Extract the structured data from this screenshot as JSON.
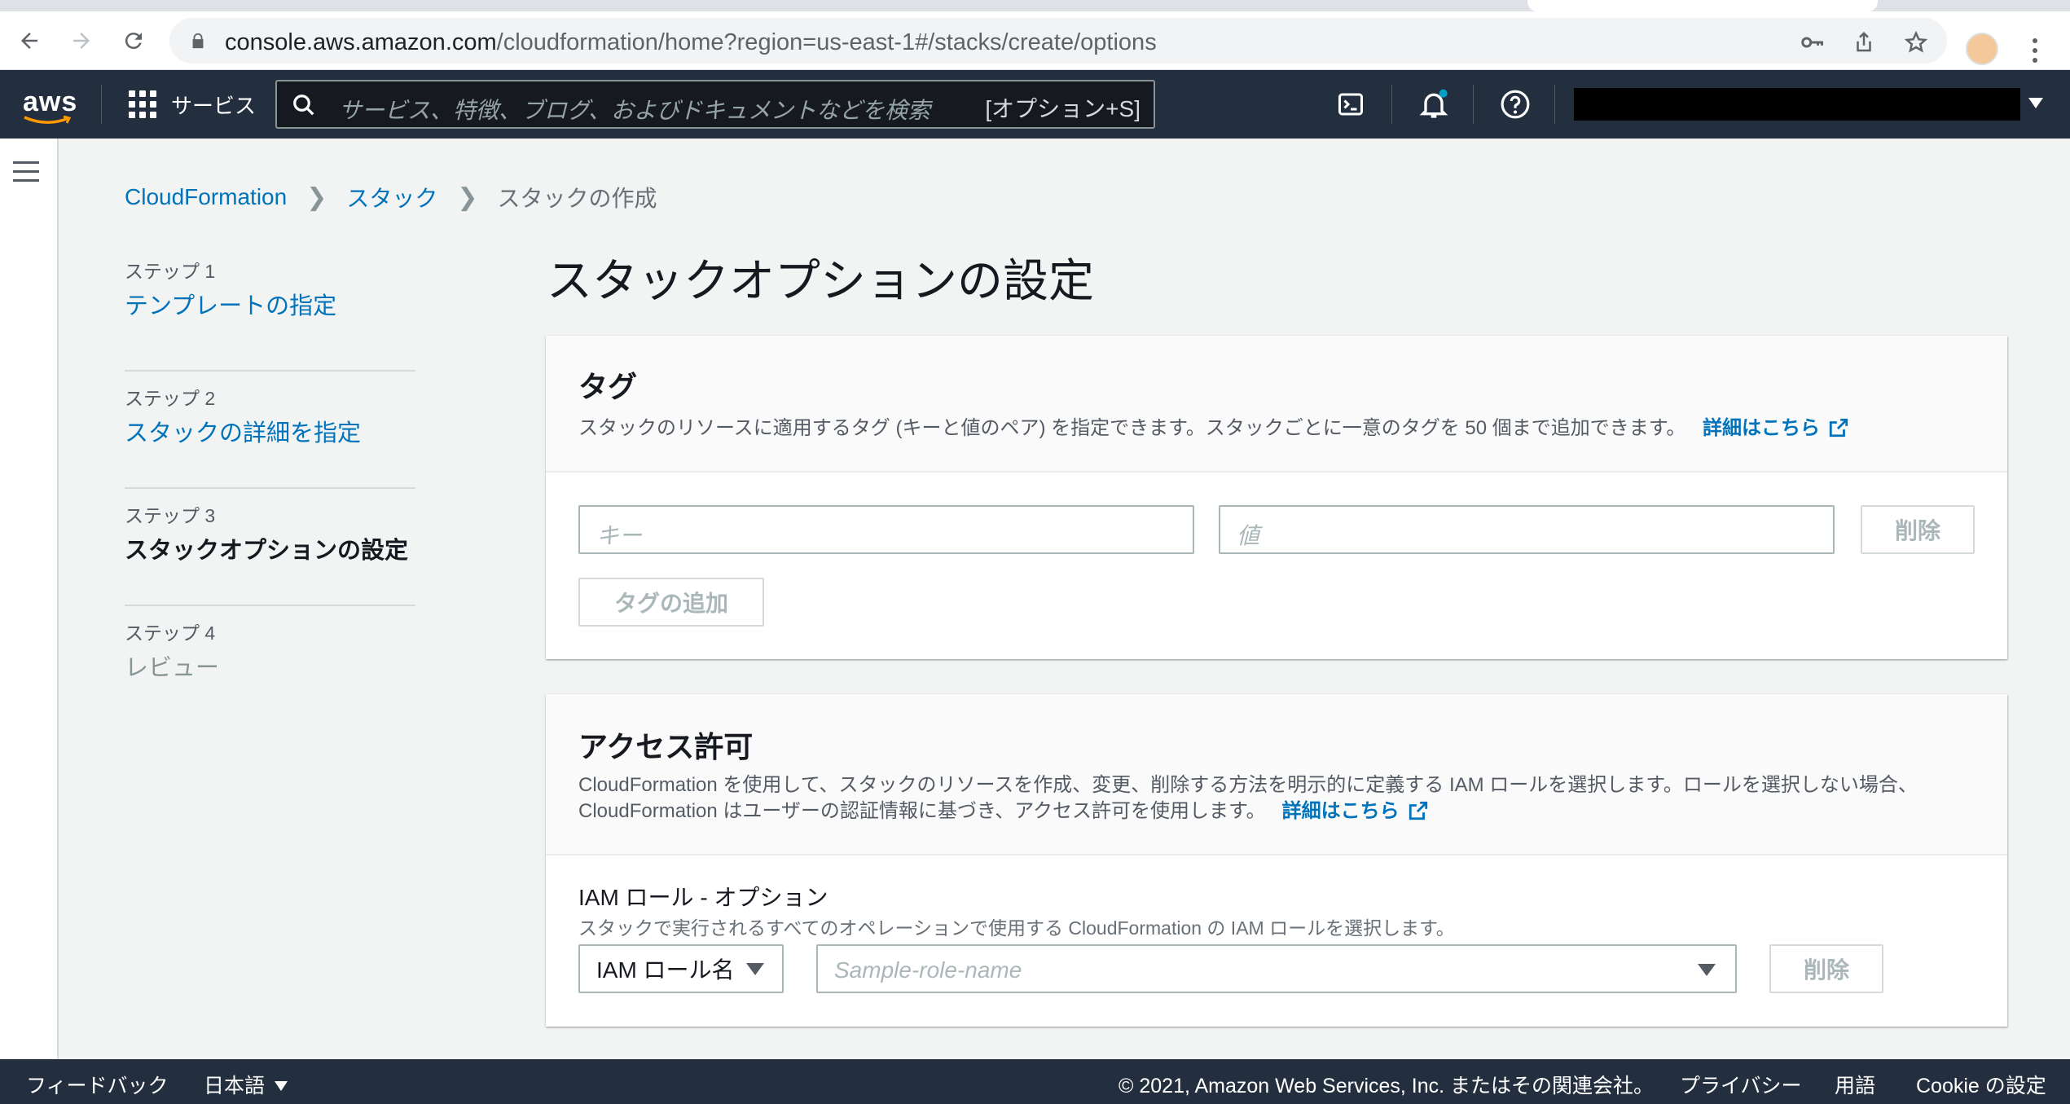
{
  "browser": {
    "url_host": "console.aws.amazon.com",
    "url_path": "/cloudformation/home?region=us-east-1#/stacks/create/options"
  },
  "awsnav": {
    "logo": "aws",
    "services_label": "サービス",
    "search_placeholder": "サービス、特徴、ブログ、およびドキュメントなどを検索",
    "search_shortcut": "[オプション+S]"
  },
  "breadcrumb": {
    "items": [
      "CloudFormation",
      "スタック"
    ],
    "current": "スタックの作成"
  },
  "steps": [
    {
      "num": "ステップ 1",
      "label": "テンプレートの指定"
    },
    {
      "num": "ステップ 2",
      "label": "スタックの詳細を指定"
    },
    {
      "num": "ステップ 3",
      "label": "スタックオプションの設定"
    },
    {
      "num": "ステップ 4",
      "label": "レビュー"
    }
  ],
  "page_title": "スタックオプションの設定",
  "tags_card": {
    "title": "タグ",
    "description": "スタックのリソースに適用するタグ (キーと値のペア) を指定できます。スタックごとに一意のタグを 50 個まで追加できます。",
    "learn_more": "詳細はこちら",
    "key_placeholder": "キー",
    "value_placeholder": "値",
    "remove_label": "削除",
    "add_tag_label": "タグの追加"
  },
  "permissions_card": {
    "title": "アクセス許可",
    "description_line1": "CloudFormation を使用して、スタックのリソースを作成、変更、削除する方法を明示的に定義する IAM ロールを選択します。ロールを選択しない場合、",
    "description_line2": "CloudFormation はユーザーの認証情報に基づき、アクセス許可を使用します。",
    "learn_more": "詳細はこちら",
    "iam_label": "IAM ロール - オプション",
    "iam_desc": "スタックで実行されるすべてのオペレーションで使用する CloudFormation の IAM ロールを選択します。",
    "role_type": "IAM ロール名",
    "role_placeholder": "Sample-role-name",
    "remove_label": "削除"
  },
  "footer": {
    "feedback": "フィードバック",
    "language": "日本語",
    "copyright": "© 2021, Amazon Web Services, Inc. またはその関連会社。",
    "privacy": "プライバシー",
    "terms": "用語",
    "cookie": "Cookie の設定"
  },
  "colors": {
    "nav_bg": "#232f3e",
    "link": "#0073bb",
    "page_bg": "#f2f3f3",
    "notification_dot": "#00a1c9"
  }
}
